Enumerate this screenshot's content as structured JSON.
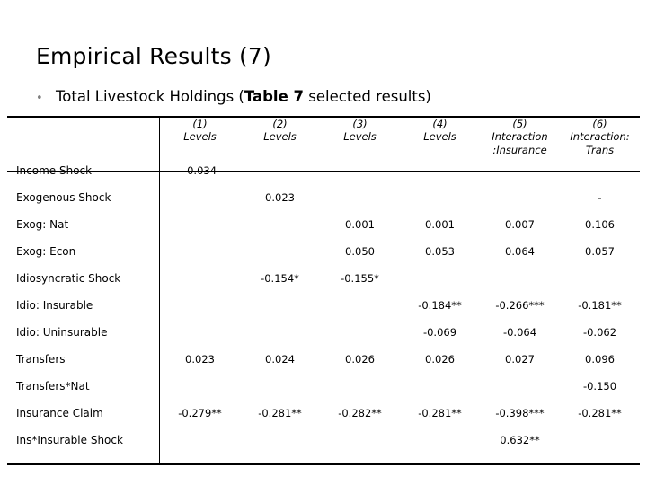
{
  "slide": {
    "title": "Empirical Results (7)",
    "bullet_marker": "•",
    "bullet_prefix": "Total Livestock Holdings (",
    "bullet_bold": "Table 7",
    "bullet_suffix": " selected results)"
  },
  "table": {
    "header": [
      {
        "num": "",
        "sub": "",
        "sub2": ""
      },
      {
        "num": "(1)",
        "sub": "Levels",
        "sub2": ""
      },
      {
        "num": "(2)",
        "sub": "Levels",
        "sub2": ""
      },
      {
        "num": "(3)",
        "sub": "Levels",
        "sub2": ""
      },
      {
        "num": "(4)",
        "sub": "Levels",
        "sub2": ""
      },
      {
        "num": "(5)",
        "sub": "Interaction",
        "sub2": ":Insurance"
      },
      {
        "num": "(6)",
        "sub": "Interaction:",
        "sub2": "Trans"
      }
    ],
    "rows": [
      {
        "label": "Income Shock",
        "c1": "-0.034",
        "c2": "",
        "c3": "",
        "c4": "",
        "c5": "",
        "c6": ""
      },
      {
        "label": "Exogenous Shock",
        "c1": "",
        "c2": "0.023",
        "c3": "",
        "c4": "",
        "c5": "",
        "c6": "-"
      },
      {
        "label": "Exog: Nat",
        "c1": "",
        "c2": "",
        "c3": "0.001",
        "c4": "0.001",
        "c5": "0.007",
        "c6": "0.106"
      },
      {
        "label": "Exog: Econ",
        "c1": "",
        "c2": "",
        "c3": "0.050",
        "c4": "0.053",
        "c5": "0.064",
        "c6": "0.057"
      },
      {
        "label": "Idiosyncratic Shock",
        "c1": "",
        "c2": "-0.154*",
        "c3": "-0.155*",
        "c4": "",
        "c5": "",
        "c6": ""
      },
      {
        "label": "Idio: Insurable",
        "c1": "",
        "c2": "",
        "c3": "",
        "c4": "-0.184**",
        "c5": "-0.266***",
        "c6": "-0.181**"
      },
      {
        "label": "Idio: Uninsurable",
        "c1": "",
        "c2": "",
        "c3": "",
        "c4": "-0.069",
        "c5": "-0.064",
        "c6": "-0.062"
      },
      {
        "label": "Transfers",
        "c1": "0.023",
        "c2": "0.024",
        "c3": "0.026",
        "c4": "0.026",
        "c5": "0.027",
        "c6": "0.096"
      },
      {
        "label": "Transfers*Nat",
        "c1": "",
        "c2": "",
        "c3": "",
        "c4": "",
        "c5": "",
        "c6": "-0.150"
      },
      {
        "label": "Insurance Claim",
        "c1": "-0.279**",
        "c2": "-0.281**",
        "c3": "-0.282**",
        "c4": "-0.281**",
        "c5": "-0.398***",
        "c6": "-0.281**"
      },
      {
        "label": "Ins*Insurable Shock",
        "c1": "",
        "c2": "",
        "c3": "",
        "c4": "",
        "c5": "0.632**",
        "c6": ""
      }
    ]
  }
}
